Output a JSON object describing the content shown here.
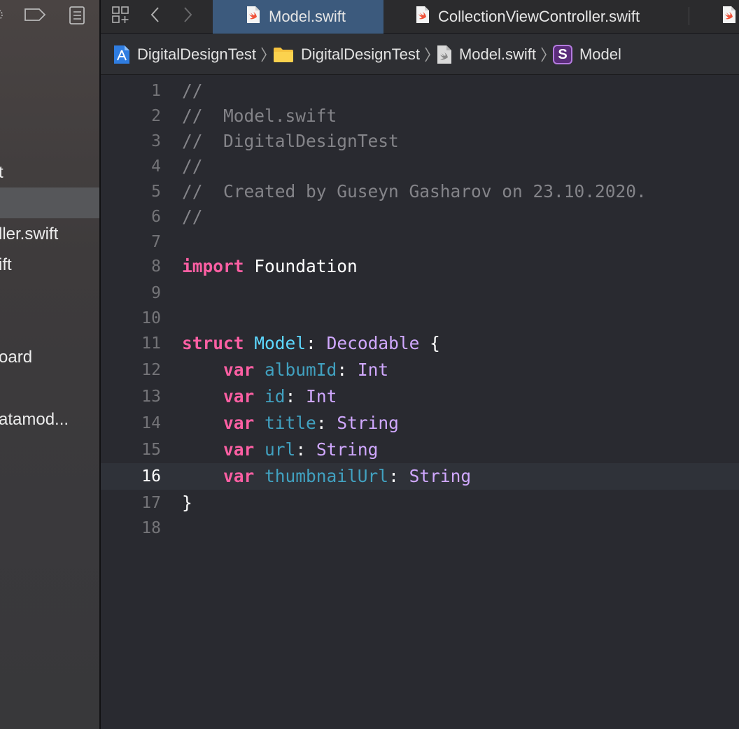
{
  "sidebar": {
    "items": [
      {
        "label": "t"
      },
      {
        "label": ""
      },
      {
        "label": "ller.swift"
      },
      {
        "label": "ift"
      },
      {
        "label": "oard"
      },
      {
        "label": "atamod..."
      }
    ]
  },
  "tabs": [
    {
      "label": "Model.swift",
      "active": true,
      "icon": "swift-file-icon"
    },
    {
      "label": "CollectionViewController.swift",
      "active": false,
      "icon": "swift-file-icon"
    }
  ],
  "breadcrumb": [
    {
      "label": "DigitalDesignTest",
      "icon": "xcode-project-icon"
    },
    {
      "label": "DigitalDesignTest",
      "icon": "folder-icon"
    },
    {
      "label": "Model.swift",
      "icon": "swift-file-icon"
    },
    {
      "label": "Model",
      "icon": "struct-symbol-icon",
      "symbol": "S"
    }
  ],
  "editor": {
    "current_line": 16,
    "lines": [
      {
        "n": "1",
        "tokens": [
          {
            "t": "//",
            "c": "comment"
          }
        ]
      },
      {
        "n": "2",
        "tokens": [
          {
            "t": "//  Model.swift",
            "c": "comment"
          }
        ]
      },
      {
        "n": "3",
        "tokens": [
          {
            "t": "//  DigitalDesignTest",
            "c": "comment"
          }
        ]
      },
      {
        "n": "4",
        "tokens": [
          {
            "t": "//",
            "c": "comment"
          }
        ]
      },
      {
        "n": "5",
        "tokens": [
          {
            "t": "//  Created by Guseyn Gasharov on 23.10.2020.",
            "c": "comment"
          }
        ]
      },
      {
        "n": "6",
        "tokens": [
          {
            "t": "//",
            "c": "comment"
          }
        ]
      },
      {
        "n": "7",
        "tokens": []
      },
      {
        "n": "8",
        "tokens": [
          {
            "t": "import",
            "c": "kw"
          },
          {
            "t": " Foundation",
            "c": "plain"
          }
        ]
      },
      {
        "n": "9",
        "tokens": []
      },
      {
        "n": "10",
        "tokens": []
      },
      {
        "n": "11",
        "tokens": [
          {
            "t": "struct",
            "c": "kw"
          },
          {
            "t": " ",
            "c": "plain"
          },
          {
            "t": "Model",
            "c": "type-decl"
          },
          {
            "t": ": ",
            "c": "plain"
          },
          {
            "t": "Decodable",
            "c": "proto"
          },
          {
            "t": " {",
            "c": "plain"
          }
        ]
      },
      {
        "n": "12",
        "tokens": [
          {
            "t": "    ",
            "c": "plain"
          },
          {
            "t": "var",
            "c": "kw"
          },
          {
            "t": " ",
            "c": "plain"
          },
          {
            "t": "albumId",
            "c": "prop"
          },
          {
            "t": ": ",
            "c": "plain"
          },
          {
            "t": "Int",
            "c": "type"
          }
        ]
      },
      {
        "n": "13",
        "tokens": [
          {
            "t": "    ",
            "c": "plain"
          },
          {
            "t": "var",
            "c": "kw"
          },
          {
            "t": " ",
            "c": "plain"
          },
          {
            "t": "id",
            "c": "prop"
          },
          {
            "t": ": ",
            "c": "plain"
          },
          {
            "t": "Int",
            "c": "type"
          }
        ]
      },
      {
        "n": "14",
        "tokens": [
          {
            "t": "    ",
            "c": "plain"
          },
          {
            "t": "var",
            "c": "kw"
          },
          {
            "t": " ",
            "c": "plain"
          },
          {
            "t": "title",
            "c": "prop"
          },
          {
            "t": ": ",
            "c": "plain"
          },
          {
            "t": "String",
            "c": "type"
          }
        ]
      },
      {
        "n": "15",
        "tokens": [
          {
            "t": "    ",
            "c": "plain"
          },
          {
            "t": "var",
            "c": "kw"
          },
          {
            "t": " ",
            "c": "plain"
          },
          {
            "t": "url",
            "c": "prop"
          },
          {
            "t": ": ",
            "c": "plain"
          },
          {
            "t": "String",
            "c": "type"
          }
        ]
      },
      {
        "n": "16",
        "tokens": [
          {
            "t": "    ",
            "c": "plain"
          },
          {
            "t": "var",
            "c": "kw"
          },
          {
            "t": " ",
            "c": "plain"
          },
          {
            "t": "thumbnailUrl",
            "c": "prop"
          },
          {
            "t": ": ",
            "c": "plain"
          },
          {
            "t": "String",
            "c": "type"
          }
        ]
      },
      {
        "n": "17",
        "tokens": [
          {
            "t": "}",
            "c": "plain"
          }
        ]
      },
      {
        "n": "18",
        "tokens": []
      }
    ]
  },
  "colors": {
    "background": "#292a30",
    "keyword": "#fc5fa3",
    "comment": "#848489",
    "type_declaration": "#5dd8ff",
    "type": "#d0a8ff",
    "property": "#41a1c0",
    "active_tab": "#3c5a7d",
    "current_line": "#2f3239"
  }
}
